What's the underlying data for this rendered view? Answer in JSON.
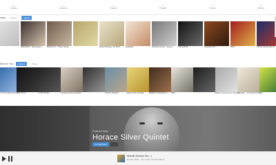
{
  "stats": [
    {
      "value": "—",
      "label": "Artists"
    },
    {
      "value": "—",
      "label": "Albums"
    },
    {
      "value": "—",
      "label": "Tracks"
    },
    {
      "value": "—",
      "label": "Played"
    },
    {
      "value": "—",
      "label": "Hours"
    },
    {
      "value": "—",
      "label": "Library"
    }
  ],
  "recent": {
    "title": "ently",
    "tabs": [
      "Played",
      "Added"
    ],
    "active_tab": 1,
    "items": [
      {
        "title": "",
        "sub": "",
        "colors": [
          "#e7e7e7",
          "#bdbdbd"
        ]
      },
      {
        "title": "Billie Eilish · Everything I …",
        "sub": "",
        "colors": [
          "#3b2f2c",
          "#d8c5b0"
        ]
      },
      {
        "title": "Beethoven · Piano Sonat…",
        "sub": "",
        "colors": [
          "#6f5a4a",
          "#c9b9a3"
        ]
      },
      {
        "title": "",
        "sub": "",
        "colors": [
          "#b5a56a",
          "#e3d9a5"
        ]
      },
      {
        "title": "Marco Beasley, St. Mich…",
        "sub": "",
        "colors": [
          "#e9e2c9",
          "#b9a77b"
        ]
      },
      {
        "title": "Matthäus · …",
        "sub": "",
        "colors": [
          "#f2e6d5",
          "#c48b66"
        ]
      },
      {
        "title": "Unknown Artist · Veneer…",
        "sub": "",
        "colors": [
          "#777",
          "#cfcfcf"
        ]
      },
      {
        "title": "The Last Pl…",
        "sub": "",
        "colors": [
          "#111",
          "#6a6a6a"
        ]
      },
      {
        "title": "Unknown Art…",
        "sub": "",
        "colors": [
          "#8c4a1d",
          "#2e1a10"
        ]
      },
      {
        "title": "Sono",
        "sub": "",
        "colors": [
          "#a31d1d",
          "#e0b24a"
        ]
      },
      {
        "title": "You're Gonna Get It!",
        "sub": "",
        "colors": [
          "#1a2d6b",
          "#b73b2c"
        ]
      },
      {
        "title": "Long After Dark",
        "sub": "",
        "colors": [
          "#1b1b1b",
          "#5a5a5a"
        ]
      }
    ]
  },
  "suggested": {
    "title": "ded for You",
    "tabs": [
      "Albums",
      "Artists"
    ],
    "active_tab": 0,
    "items": [
      {
        "title": "Gordon & The Alan Parsons…",
        "sub": "",
        "colors": [
          "#2a63a8",
          "#9ab9df"
        ]
      },
      {
        "title": "Just Fresh",
        "sub": "",
        "colors": [
          "#111",
          "#3c3c3c"
        ]
      },
      {
        "title": "Vivid Tell 3P",
        "sub": "",
        "colors": [
          "#222",
          "#595959"
        ]
      },
      {
        "title": "Sonata Conso Guaraldi",
        "sub": "",
        "colors": [
          "#d9d0c3",
          "#7a6e60"
        ]
      },
      {
        "title": "",
        "sub": "",
        "colors": [
          "#2e2e2e",
          "#9b9b9b"
        ]
      },
      {
        "title": "Ferrero Paradox",
        "sub": "",
        "colors": [
          "#6a8fa8",
          "#bfa88a"
        ]
      },
      {
        "title": "Bach Violin Sonatas",
        "sub": "",
        "colors": [
          "#e8d57a",
          "#b48f2b"
        ]
      },
      {
        "title": "Magnum Chandlers e…",
        "sub": "",
        "colors": [
          "#402c1e",
          "#a07550"
        ]
      },
      {
        "title": "MPS",
        "sub": "",
        "colors": [
          "#e9e6de",
          "#6e6a60"
        ]
      },
      {
        "title": "",
        "sub": "",
        "colors": [
          "#1d1d1d",
          "#6a6a6a"
        ]
      },
      {
        "title": "Bartók Concerto for Orchestra",
        "sub": "",
        "colors": [
          "#aaa",
          "#e5e5e5"
        ]
      },
      {
        "title": "Schubert · 24 Sonata Piano",
        "sub": "",
        "colors": [
          "#efe9dc",
          "#b5aa94"
        ]
      },
      {
        "title": "A.K.",
        "sub": "",
        "colors": [
          "#d2e44a",
          "#2b6a2f"
        ]
      }
    ]
  },
  "feature": {
    "kicker": "Featured Artist",
    "artist": "Horace Silver Quintet",
    "play_label": "► Play Now",
    "more_label": "···",
    "accent": "#4a90d9"
  },
  "player": {
    "track_title": "Nutville (Horace Silv…)",
    "track_sub": "Horace Silver · The Cape Verdean Blues"
  }
}
